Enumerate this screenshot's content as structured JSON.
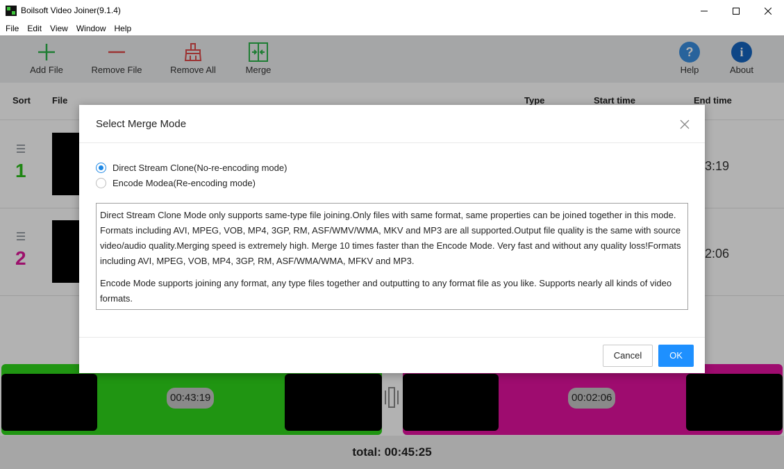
{
  "window": {
    "title": "Boilsoft Video Joiner(9.1.4)"
  },
  "menu": [
    "File",
    "Edit",
    "View",
    "Window",
    "Help"
  ],
  "toolbar": {
    "add_file": "Add File",
    "remove_file": "Remove File",
    "remove_all": "Remove All",
    "merge": "Merge",
    "help": "Help",
    "about": "About"
  },
  "columns": {
    "sort": "Sort",
    "file": "File",
    "type": "Type",
    "start_time": "Start time",
    "end_time": "End time"
  },
  "rows": [
    {
      "number": "1",
      "end_time_partial": ":43:19",
      "color": "#2bbf1a"
    },
    {
      "number": "2",
      "end_time_partial": ":02:06",
      "color": "#e0179b"
    }
  ],
  "timeline": {
    "clips": [
      {
        "duration": "00:43:19",
        "color": "#2ed61a"
      },
      {
        "duration": "00:02:06",
        "color": "#e3129f"
      }
    ]
  },
  "total": "total: 00:45:25",
  "dialog": {
    "title": "Select Merge Mode",
    "option_direct": "Direct Stream Clone(No-re-encoding mode)",
    "option_encode": "Encode Modea(Re-encoding mode)",
    "selected": "direct",
    "description_p1": "Direct Stream Clone Mode only supports same-type file joining.Only files with same format, same properties can be joined together in this mode. Formats including AVI, MPEG, VOB, MP4, 3GP, RM, ASF/WMV/WMA, MKV and MP3 are all supported.Output file quality is the same with source video/audio quality.Merging speed is extremely high. Merge 10 times faster than the Encode Mode. Very fast and without any quality loss!Formats including AVI, MPEG, VOB, MP4, 3GP, RM, ASF/WMA/WMA, MFKV and MP3.",
    "description_p2": "Encode Mode supports joining any format, any type files together and outputting to any format file as you like. Supports nearly all kinds of video formats.",
    "cancel": "Cancel",
    "ok": "OK"
  },
  "colors": {
    "accent": "#1e90ff",
    "add": "#2bb34a",
    "remove": "#e04a4a",
    "help": "#3a8fe0",
    "about": "#1565c0"
  }
}
